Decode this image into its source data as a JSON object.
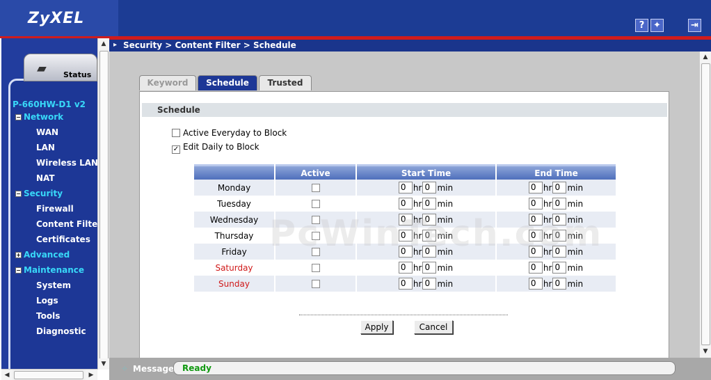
{
  "header": {
    "logo": "ZyXEL",
    "help_glyph": "?",
    "wizard_glyph": "✦",
    "logout_glyph": "⇥"
  },
  "sidebar": {
    "status_label": "Status",
    "model": "P-660HW-D1 v2",
    "groups": [
      {
        "label": "Network",
        "expander": "−",
        "items": [
          "WAN",
          "LAN",
          "Wireless LAN",
          "NAT"
        ]
      },
      {
        "label": "Security",
        "expander": "−",
        "items": [
          "Firewall",
          "Content Filter",
          "Certificates"
        ]
      },
      {
        "label": "Advanced",
        "expander": "+",
        "items": []
      },
      {
        "label": "Maintenance",
        "expander": "−",
        "items": [
          "System",
          "Logs",
          "Tools",
          "Diagnostic"
        ]
      }
    ]
  },
  "breadcrumb": "Security > Content Filter > Schedule",
  "tabs": [
    {
      "label": "Keyword",
      "state": "disabled"
    },
    {
      "label": "Schedule",
      "state": "active"
    },
    {
      "label": "Trusted",
      "state": "inactive"
    }
  ],
  "panel": {
    "title": "Schedule",
    "option_everyday": {
      "label": "Active Everyday to Block",
      "checked": false
    },
    "option_daily": {
      "label": "Edit Daily to Block",
      "checked": true
    }
  },
  "table": {
    "headers": {
      "day": "",
      "active": "Active",
      "start": "Start Time",
      "end": "End Time"
    },
    "units": {
      "hr": "hr",
      "min": "min"
    },
    "rows": [
      {
        "day": "Monday",
        "style": "dim",
        "start_hr": "0",
        "start_min": "0",
        "end_hr": "0",
        "end_min": "0"
      },
      {
        "day": "Tuesday",
        "style": "dim",
        "start_hr": "0",
        "start_min": "0",
        "end_hr": "0",
        "end_min": "0"
      },
      {
        "day": "Wednesday",
        "style": "normal",
        "start_hr": "0",
        "start_min": "0",
        "end_hr": "0",
        "end_min": "0"
      },
      {
        "day": "Thursday",
        "style": "normal",
        "start_hr": "0",
        "start_min": "0",
        "end_hr": "0",
        "end_min": "0"
      },
      {
        "day": "Friday",
        "style": "normal",
        "start_hr": "0",
        "start_min": "0",
        "end_hr": "0",
        "end_min": "0"
      },
      {
        "day": "Saturday",
        "style": "weekend",
        "start_hr": "0",
        "start_min": "0",
        "end_hr": "0",
        "end_min": "0"
      },
      {
        "day": "Sunday",
        "style": "weekend",
        "start_hr": "0",
        "start_min": "0",
        "end_hr": "0",
        "end_min": "0"
      }
    ]
  },
  "buttons": {
    "apply": "Apply",
    "cancel": "Cancel"
  },
  "message": {
    "label": "Message",
    "value": "Ready"
  },
  "watermark": "PcWinTech.com",
  "colors": {
    "brand_blue": "#1d3796",
    "accent_red": "#d01c1c",
    "nav_cyan": "#38d8f8",
    "ready_green": "#119911"
  }
}
